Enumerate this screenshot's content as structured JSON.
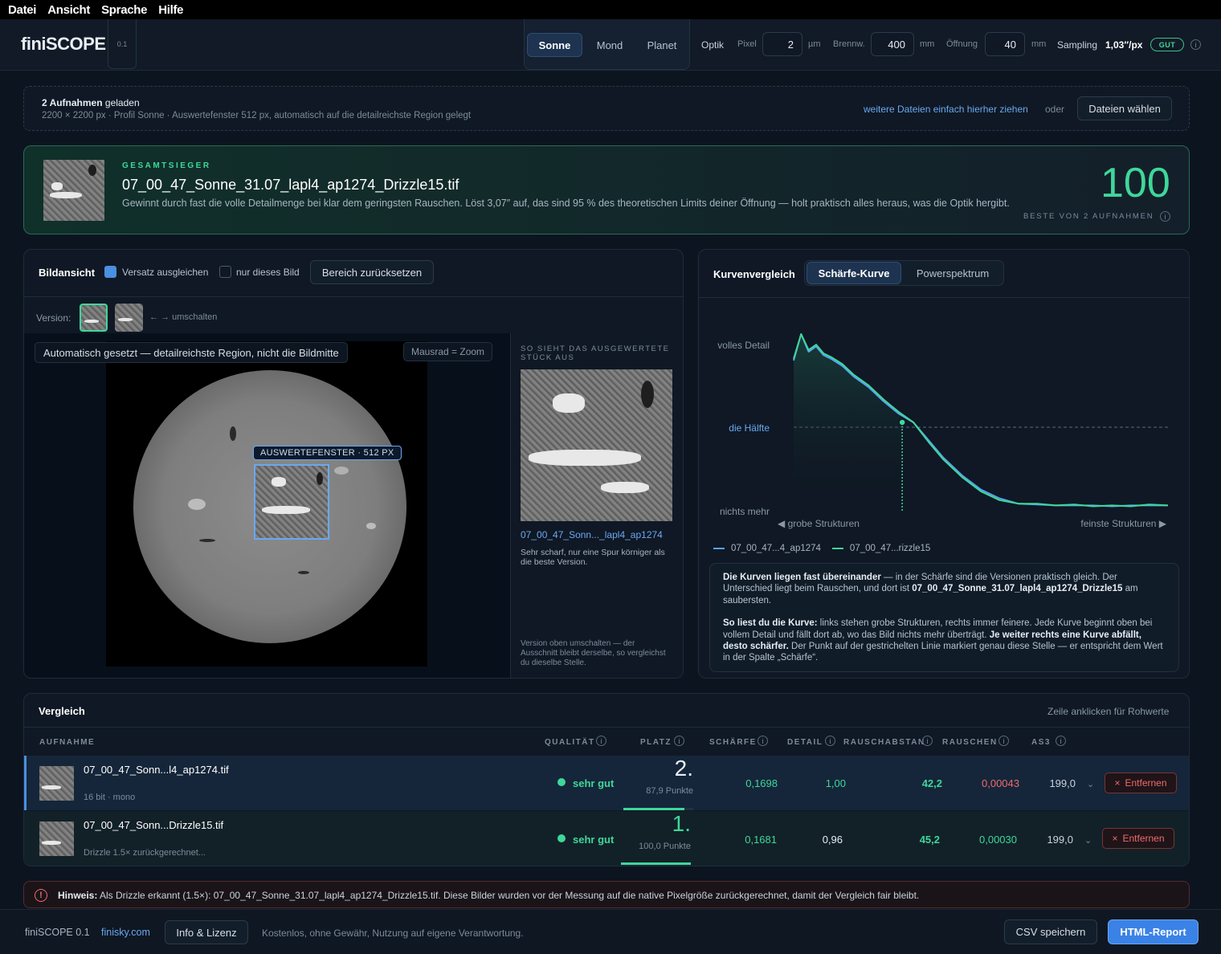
{
  "menu": [
    "Datei",
    "Ansicht",
    "Sprache",
    "Hilfe"
  ],
  "app": {
    "name": "finiSCOPE",
    "version": "0.1"
  },
  "profiles": [
    {
      "label": "Sonne",
      "active": true
    },
    {
      "label": "Mond",
      "active": false
    },
    {
      "label": "Planet",
      "active": false
    }
  ],
  "optics": {
    "label": "Optik",
    "pixel_label": "Pixel",
    "pixel_value": "2",
    "pixel_unit": "µm",
    "focal_label": "Brennw.",
    "focal_value": "400",
    "focal_unit": "mm",
    "aperture_label": "Öffnung",
    "aperture_value": "40",
    "aperture_unit": "mm",
    "sampling_label": "Sampling",
    "sampling_value": "1,03″/px",
    "sampling_badge": "GUT",
    "info": "i"
  },
  "loaded": {
    "count": "2 Aufnahmen",
    "suffix": "geladen",
    "details": "2200 × 2200 px · Profil Sonne · Auswertefenster 512 px, automatisch auf die detailreichste Region gelegt",
    "drop_hint": "weitere Dateien einfach hierher ziehen",
    "or": "oder",
    "choose_button": "Dateien wählen"
  },
  "winner": {
    "kicker": "GESAMTSIEGER",
    "filename": "07_00_47_Sonne_31.07_lapl4_ap1274_Drizzle15.tif",
    "description": "Gewinnt durch fast die volle Detailmenge bei klar dem geringsten Rauschen.  Löst 3,07″ auf, das sind 95 % des theoretischen Limits deiner Öffnung — holt praktisch alles heraus, was die Optik hergibt.",
    "score": "100",
    "score_caption": "BESTE VON 2 AUFNAHMEN"
  },
  "imageview": {
    "title": "Bildansicht",
    "offset_label": "Versatz ausgleichen",
    "only_label": "nur dieses Bild",
    "reset_button": "Bereich zurücksetzen",
    "version_label": "Version:",
    "switch_hint": "← → umschalten",
    "auto_note": "Automatisch gesetzt — detailreichste Region, nicht die Bildmitte",
    "zoom_hint": "Mausrad = Zoom",
    "window_label": "AUSWERTEFENSTER · 512 PX",
    "crop_caption": "SO SIEHT DAS AUSGEWERTETE STÜCK AUS",
    "crop_name": "07_00_47_Sonn..._lapl4_ap1274",
    "crop_desc": "Sehr scharf, nur eine Spur körniger als die beste Version.",
    "crop_footer": "Version oben umschalten — der Ausschnitt bleibt derselbe, so vergleichst du dieselbe Stelle."
  },
  "curves": {
    "title": "Kurvenvergleich",
    "tabs": [
      {
        "label": "Schärfe-Kurve",
        "active": true
      },
      {
        "label": "Powerspektrum",
        "active": false
      }
    ],
    "explain_p1_bold": "Die Kurven liegen fast übereinander",
    "explain_p1": " — in der Schärfe sind die Versionen praktisch gleich. Der Unterschied liegt beim Rauschen, und dort ist ",
    "explain_p1_file": "07_00_47_Sonne_31.07_lapl4_ap1274_Drizzle15",
    "explain_p1_end": " am saubersten.",
    "explain_p2_bold": "So liest du die Kurve:",
    "explain_p2": " links stehen grobe Strukturen, rechts immer feinere. Jede Kurve beginnt oben bei vollem Detail und fällt dort ab, wo das Bild nichts mehr überträgt. ",
    "explain_p2_bold2": "Je weiter rechts eine Kurve abfällt, desto schärfer.",
    "explain_p2_end": " Der Punkt auf der gestrichelten Linie markiert genau diese Stelle — er entspricht dem Wert in der Spalte „Schärfe“."
  },
  "chart_data": {
    "type": "line",
    "ytick_labels": [
      "volles Detail",
      "die Hälfte",
      "nichts mehr"
    ],
    "xlabel_left": "◀ grobe Strukturen",
    "xlabel_right": "feinste Strukturen ▶",
    "series": [
      {
        "name": "07_00_47...4_ap1274",
        "color": "#5aa0f0",
        "x": [
          0,
          0.02,
          0.04,
          0.06,
          0.08,
          0.1,
          0.13,
          0.16,
          0.2,
          0.24,
          0.28,
          0.32,
          0.36,
          0.4,
          0.45,
          0.5,
          0.55,
          0.6,
          0.65,
          0.7,
          0.75,
          0.8,
          0.85,
          0.9,
          0.95,
          1.0
        ],
        "y": [
          0.85,
          1.0,
          0.9,
          0.93,
          0.88,
          0.86,
          0.82,
          0.76,
          0.7,
          0.62,
          0.55,
          0.5,
          0.4,
          0.3,
          0.2,
          0.12,
          0.07,
          0.04,
          0.035,
          0.03,
          0.03,
          0.03,
          0.025,
          0.03,
          0.03,
          0.03
        ]
      },
      {
        "name": "07_00_47...rizzle15",
        "color": "#3fd79a",
        "x": [
          0,
          0.02,
          0.04,
          0.06,
          0.08,
          0.1,
          0.13,
          0.16,
          0.2,
          0.24,
          0.28,
          0.32,
          0.36,
          0.4,
          0.45,
          0.5,
          0.55,
          0.6,
          0.65,
          0.7,
          0.75,
          0.8,
          0.85,
          0.9,
          0.95,
          1.0
        ],
        "y": [
          0.86,
          1.0,
          0.91,
          0.94,
          0.89,
          0.87,
          0.83,
          0.77,
          0.71,
          0.63,
          0.56,
          0.5,
          0.39,
          0.29,
          0.19,
          0.11,
          0.06,
          0.04,
          0.04,
          0.03,
          0.035,
          0.025,
          0.03,
          0.025,
          0.035,
          0.03
        ]
      }
    ],
    "marker": {
      "x": 0.29,
      "y": 0.5
    },
    "ylim": [
      0,
      1
    ],
    "grid": false
  },
  "table": {
    "title": "Vergleich",
    "hint": "Zeile anklicken für Rohwerte",
    "columns": [
      "AUFNAHME",
      "QUALITÄT",
      "PLATZ",
      "SCHÄRFE",
      "DETAIL",
      "RAUSCHABSTAN",
      "RAUSCHEN",
      "AS3"
    ],
    "rows": [
      {
        "name": "07_00_47_Sonn...l4_ap1274.tif",
        "sub": "16 bit · mono",
        "quality": "sehr gut",
        "rank": "2.",
        "points": "87,9 Punkte",
        "sharp": "0,1698",
        "detail": "1,00",
        "snr": "42,2",
        "noise": "0,00043",
        "as3": "199,0",
        "remove": "Entfernen",
        "bar": 0.879
      },
      {
        "name": "07_00_47_Sonn...Drizzle15.tif",
        "sub": "Drizzle 1.5× zurückgerechnet...",
        "quality": "sehr gut",
        "rank": "1.",
        "points": "100,0 Punkte",
        "sharp": "0,1681",
        "detail": "0,96",
        "snr": "45,2",
        "noise": "0,00030",
        "as3": "199,0",
        "remove": "Entfernen",
        "bar": 1.0
      }
    ]
  },
  "notice": {
    "bold": "Hinweis:",
    "text": "Als Drizzle erkannt (1.5×): 07_00_47_Sonne_31.07_lapl4_ap1274_Drizzle15.tif. Diese Bilder wurden vor der Messung auf die native Pixelgröße zurückgerechnet, damit der Vergleich fair bleibt."
  },
  "footer": {
    "app": "finiSCOPE 0.1",
    "link": "finisky.com",
    "license_button": "Info & Lizenz",
    "disclaimer": "Kostenlos, ohne Gewähr, Nutzung auf eigene Verantwortung.",
    "csv_button": "CSV speichern",
    "report_button": "HTML-Report"
  }
}
